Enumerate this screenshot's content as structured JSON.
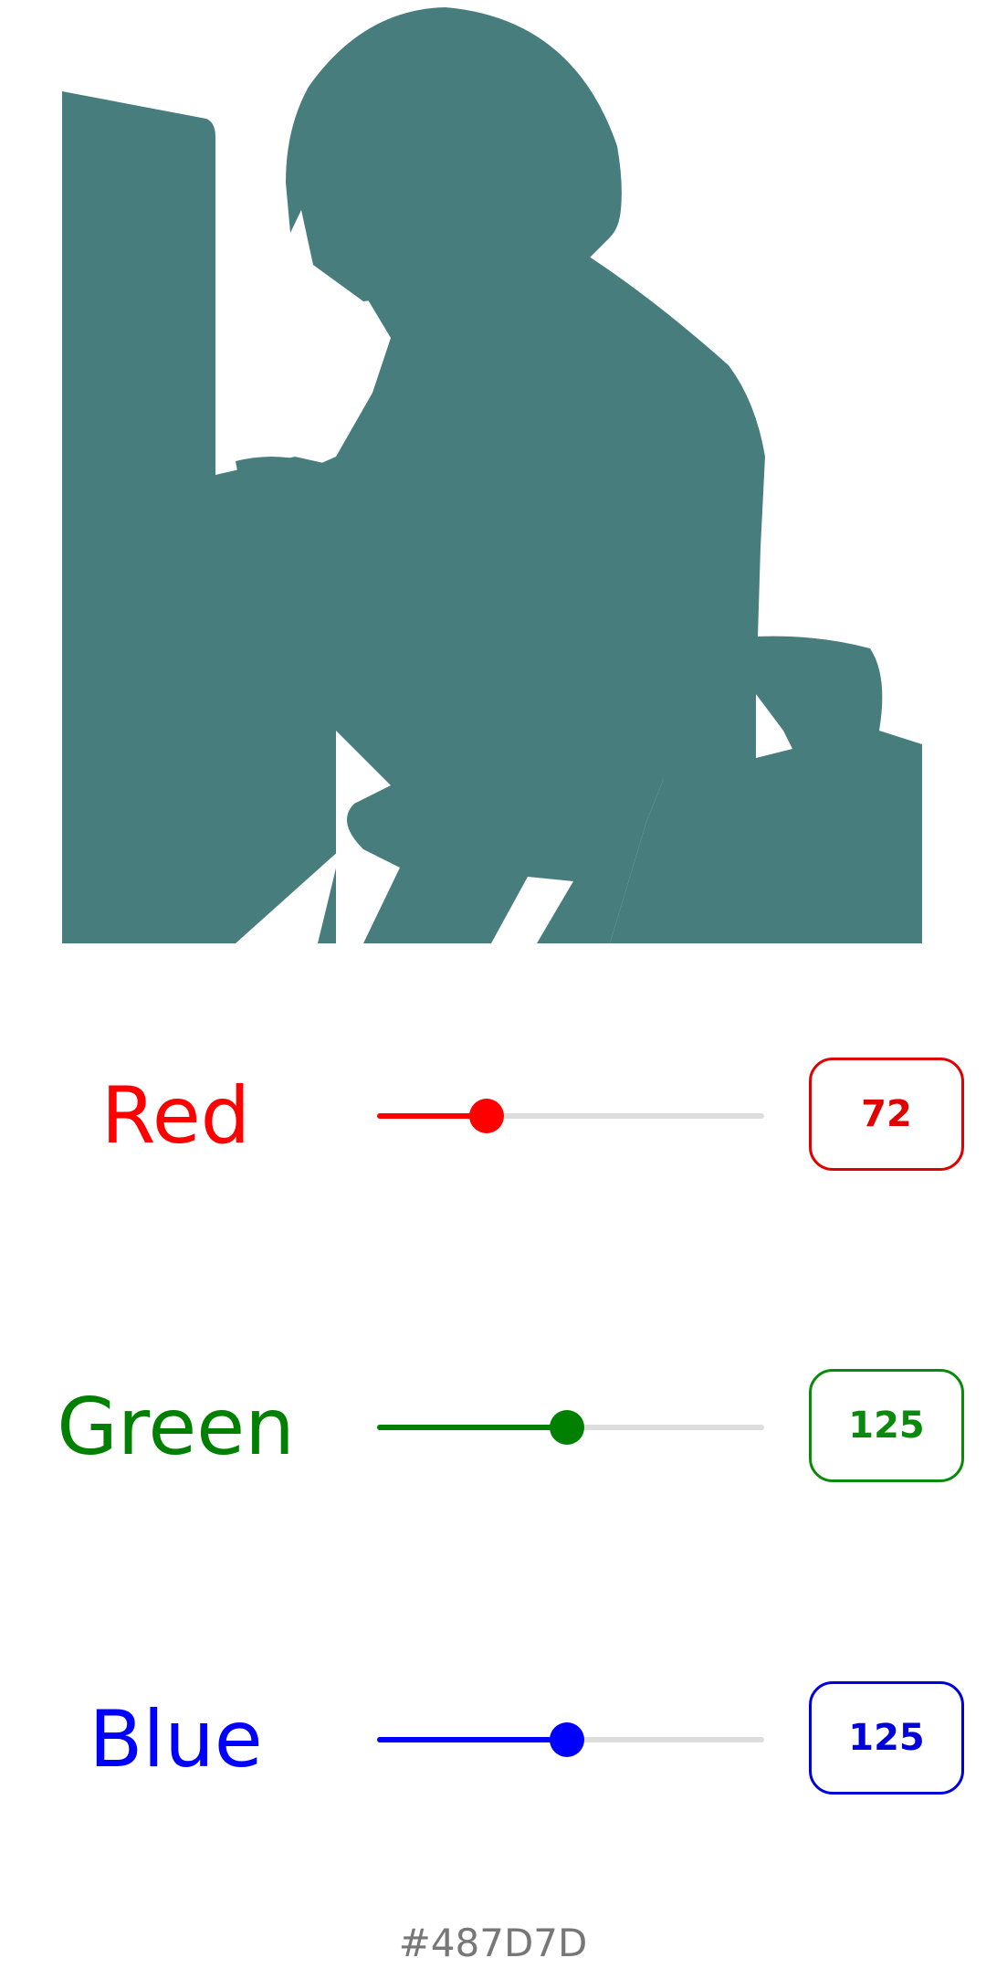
{
  "preview": {
    "color": "#487D7D",
    "icon": "silhouette-image"
  },
  "channels": [
    {
      "label": "Red",
      "value": "72",
      "level": 72,
      "max": 255,
      "color": "#ff0000",
      "box_color": "#e00000"
    },
    {
      "label": "Green",
      "value": "125",
      "level": 125,
      "max": 255,
      "color": "#008000",
      "box_color": "#0a8a0a"
    },
    {
      "label": "Blue",
      "value": "125",
      "level": 125,
      "max": 255,
      "color": "#0000ff",
      "box_color": "#0000dd"
    }
  ],
  "hex_label": "#487D7D"
}
